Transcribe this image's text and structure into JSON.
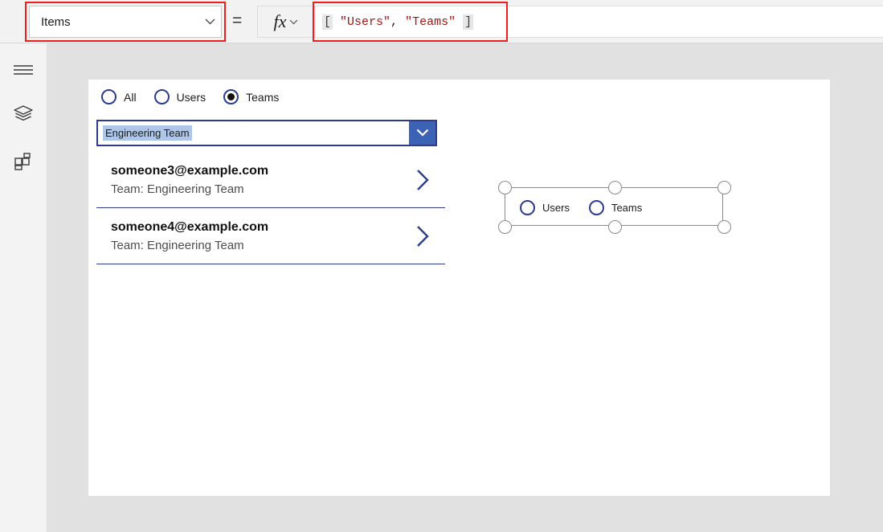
{
  "formula_bar": {
    "property_dropdown": {
      "value": "Items",
      "chevron_icon": "chevron-down-icon"
    },
    "equals": "=",
    "fx_button": {
      "glyph": "fx",
      "chevron_icon": "chevron-down-icon"
    },
    "formula": {
      "full_text": "[ \"Users\", \"Teams\" ]",
      "tokens": {
        "open_bracket": "[",
        "space1": " ",
        "string1": "\"Users\"",
        "comma": ",",
        "space2": " ",
        "string2": "\"Teams\"",
        "space3": " ",
        "close_bracket": "]"
      },
      "colors": {
        "string": "#a31515",
        "bracket_bg": "#e6e6e6",
        "punctuation": "#1b1b1b"
      }
    },
    "annotation_color": "#f01d1d"
  },
  "left_rail": {
    "items": [
      {
        "name": "hamburger-menu",
        "icon": "hamburger-icon"
      },
      {
        "name": "tree-view",
        "icon": "layers-icon"
      },
      {
        "name": "insert",
        "icon": "components-grid-icon"
      }
    ]
  },
  "app_screen": {
    "radio_group": {
      "options": [
        {
          "label": "All",
          "checked": false
        },
        {
          "label": "Users",
          "checked": false
        },
        {
          "label": "Teams",
          "checked": true
        }
      ],
      "accent_color": "#2c3c8c"
    },
    "dropdown": {
      "value": "Engineering Team",
      "chevron_icon": "chevron-down-icon",
      "button_color": "#3b62b5",
      "selection_highlight": "#aec7e8"
    },
    "gallery": {
      "items": [
        {
          "title": "someone3@example.com",
          "subtitle": "Team: Engineering Team",
          "chevron_icon": "chevron-right-icon"
        },
        {
          "title": "someone4@example.com",
          "subtitle": "Team: Engineering Team",
          "chevron_icon": "chevron-right-icon"
        }
      ]
    }
  },
  "selected_control": {
    "type": "radio-group",
    "options": [
      {
        "label": "Users",
        "checked": false
      },
      {
        "label": "Teams",
        "checked": false
      }
    ],
    "handles": [
      "top-left",
      "top-middle",
      "top-right",
      "bottom-left",
      "bottom-middle",
      "bottom-right"
    ]
  }
}
